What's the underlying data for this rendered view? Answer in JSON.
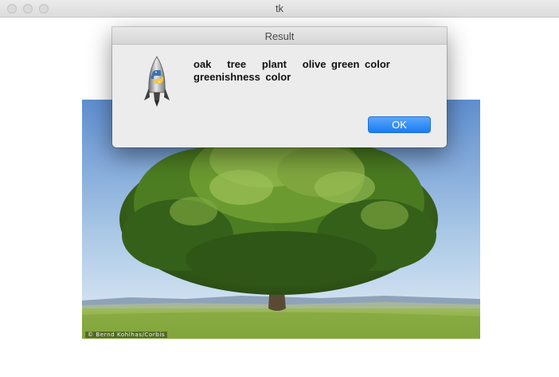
{
  "window": {
    "title": "tk"
  },
  "photo": {
    "credit": "© Bernd Kohlhas/Corbis"
  },
  "dialog": {
    "title": "Result",
    "message": "oak   tree   plant   olive green color\ngreenishness color",
    "ok_label": "OK",
    "icon": "python-rocket-icon"
  },
  "colors": {
    "accent": "#1a7cf2",
    "dialog_bg": "#ececec",
    "sky_top": "#5f8ecf",
    "grass": "#7da33a"
  }
}
